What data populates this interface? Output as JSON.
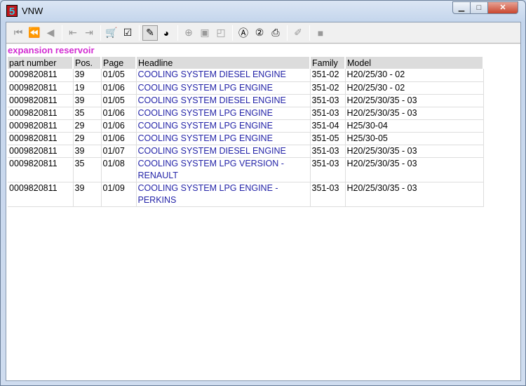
{
  "window": {
    "title": "VNW",
    "app_icon_text": "5"
  },
  "toolbar": [
    {
      "name": "first-icon",
      "glyph": "⏮",
      "enabled": false
    },
    {
      "name": "previous-fast-icon",
      "glyph": "⏪",
      "enabled": false
    },
    {
      "name": "previous-icon",
      "glyph": "◀",
      "enabled": false
    },
    {
      "sep": true
    },
    {
      "name": "back-page-icon",
      "glyph": "⇤",
      "enabled": false
    },
    {
      "name": "forward-page-icon",
      "glyph": "⇥",
      "enabled": false
    },
    {
      "sep": true
    },
    {
      "name": "cart-icon",
      "glyph": "🛒",
      "enabled": true
    },
    {
      "name": "checklist-icon",
      "glyph": "☑",
      "enabled": true
    },
    {
      "sep": true
    },
    {
      "name": "tools-icon",
      "glyph": "✎",
      "enabled": true,
      "pressed": true
    },
    {
      "name": "globe-icon",
      "glyph": "◕",
      "enabled": true
    },
    {
      "sep": true
    },
    {
      "name": "zoom-in-icon",
      "glyph": "⊕",
      "enabled": false
    },
    {
      "name": "page-icon",
      "glyph": "▣",
      "enabled": false
    },
    {
      "name": "page-corner-icon",
      "glyph": "◰",
      "enabled": false
    },
    {
      "sep": true
    },
    {
      "name": "search-a-icon",
      "glyph": "Ⓐ",
      "enabled": true
    },
    {
      "name": "search-2-icon",
      "glyph": "②",
      "enabled": true
    },
    {
      "name": "print-icon",
      "glyph": "⎙",
      "enabled": true
    },
    {
      "sep": true
    },
    {
      "name": "note-icon",
      "glyph": "✐",
      "enabled": false
    },
    {
      "sep": true
    },
    {
      "name": "stop-icon",
      "glyph": "■",
      "enabled": false
    }
  ],
  "heading": "expansion reservoir",
  "table": {
    "columns": [
      "part number",
      "Pos.",
      "Page",
      "Headline",
      "Family",
      "Model"
    ],
    "rows": [
      [
        "0009820811",
        "39",
        "01/05",
        "COOLING SYSTEM DIESEL ENGINE",
        "351-02",
        "H20/25/30 - 02"
      ],
      [
        "0009820811",
        "19",
        "01/06",
        "COOLING SYSTEM LPG ENGINE",
        "351-02",
        "H20/25/30 - 02"
      ],
      [
        "0009820811",
        "39",
        "01/05",
        "COOLING SYSTEM DIESEL ENGINE",
        "351-03",
        "H20/25/30/35 - 03"
      ],
      [
        "0009820811",
        "35",
        "01/06",
        "COOLING SYSTEM LPG ENGINE",
        "351-03",
        "H20/25/30/35 - 03"
      ],
      [
        "0009820811",
        "29",
        "01/06",
        "COOLING SYSTEM LPG ENGINE",
        "351-04",
        "H25/30-04"
      ],
      [
        "0009820811",
        "29",
        "01/06",
        "COOLING SYSTEM LPG ENGINE",
        "351-05",
        "H25/30-05"
      ],
      [
        "0009820811",
        "39",
        "01/07",
        "COOLING SYSTEM DIESEL ENGINE",
        "351-03",
        "H20/25/30/35 - 03"
      ],
      [
        "0009820811",
        "35",
        "01/08",
        "COOLING SYSTEM LPG VERSION - RENAULT",
        "351-03",
        "H20/25/30/35 - 03"
      ],
      [
        "0009820811",
        "39",
        "01/09",
        "COOLING SYSTEM LPG ENGINE - PERKINS",
        "351-03",
        "H20/25/30/35 - 03"
      ]
    ]
  }
}
